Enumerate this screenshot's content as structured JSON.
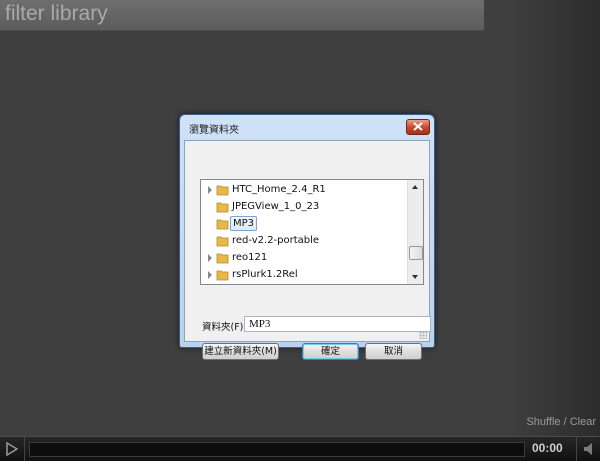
{
  "filter": {
    "placeholder": "filter library"
  },
  "controls": {
    "shuffle": "Shuffle",
    "separator": "/",
    "clear": "Clear"
  },
  "player": {
    "time": "00:00"
  },
  "dialog": {
    "title": "瀏覽資料夾",
    "tree": [
      {
        "label": "HTC_Home_2.4_R1",
        "expandable": true
      },
      {
        "label": "JPEGView_1_0_23",
        "expandable": false
      },
      {
        "label": "MP3",
        "expandable": false,
        "selected": true
      },
      {
        "label": "red-v2.2-portable",
        "expandable": false
      },
      {
        "label": "reo121",
        "expandable": true
      },
      {
        "label": "rsPlurk1.2Rel",
        "expandable": true
      }
    ],
    "folder_label": "資料夾(F):",
    "folder_value": "MP3",
    "new_folder_button": "建立新資料夾(M)",
    "ok_button": "確定",
    "cancel_button": "取消"
  },
  "colors": {
    "folder": "#e8b84a",
    "selection_border": "#7da2ce",
    "background": "#3f3f3f"
  }
}
